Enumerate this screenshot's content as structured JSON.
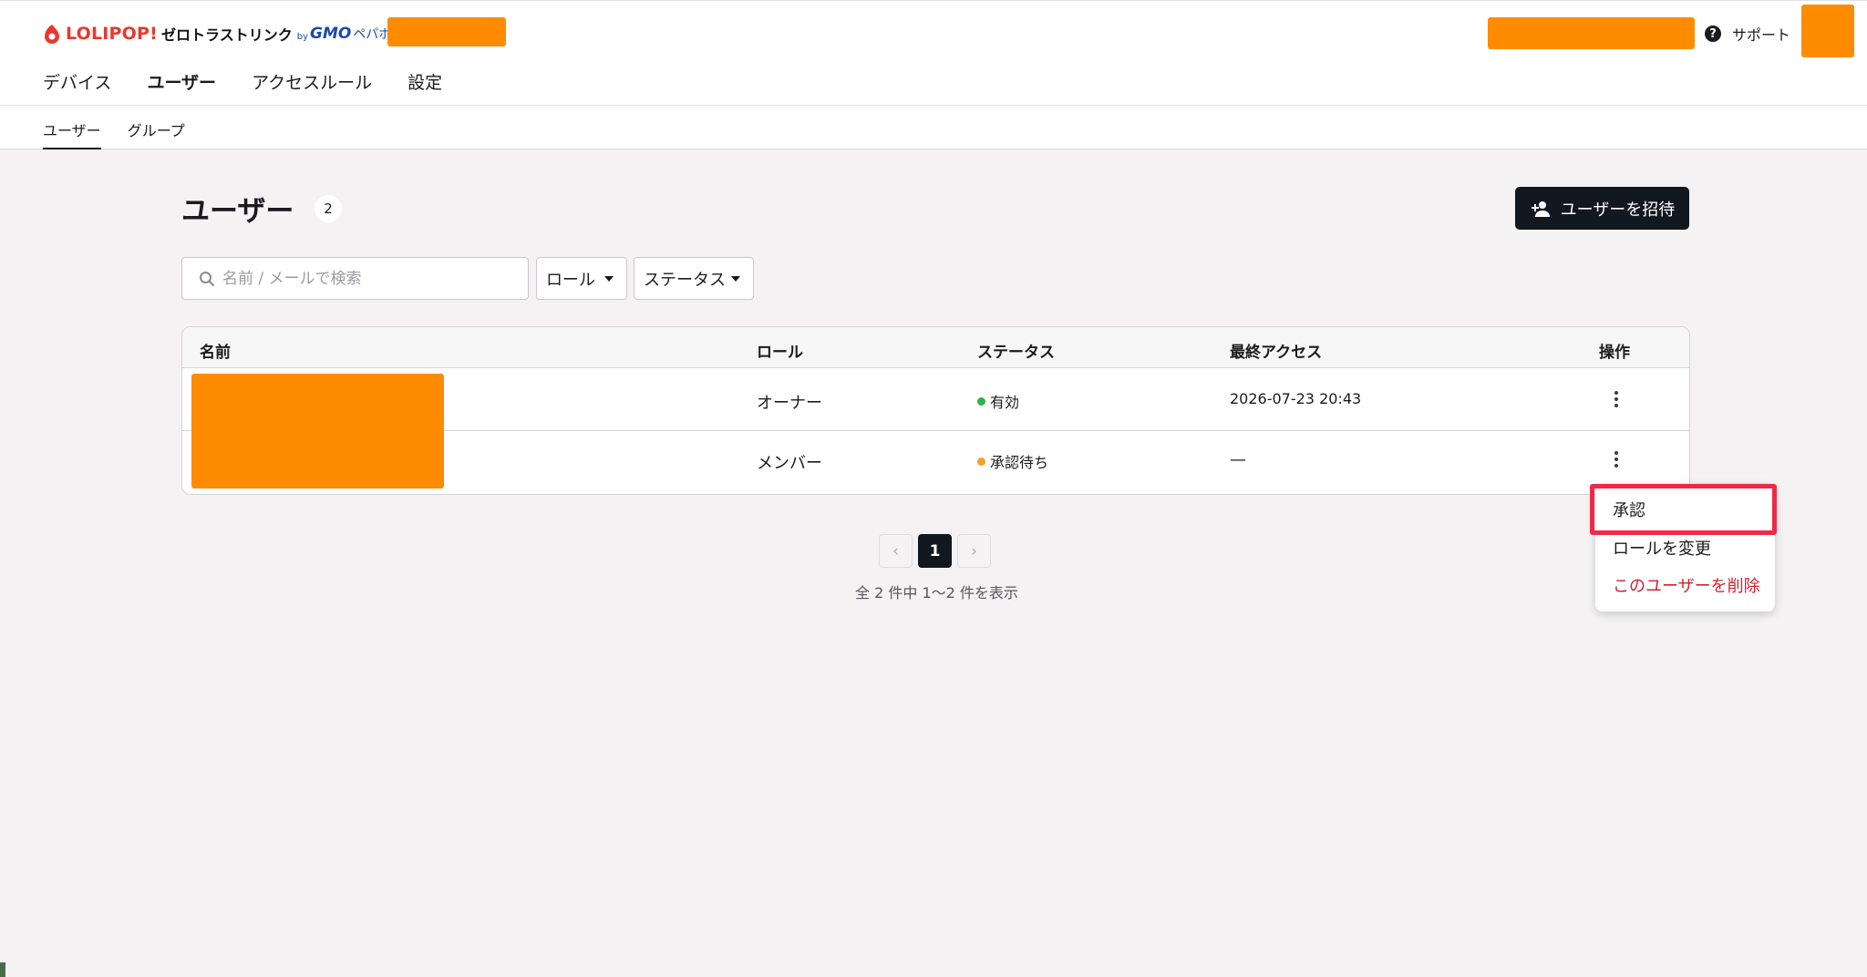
{
  "brand": {
    "lolipop": "LOLIPOP!",
    "product": "ゼロトラストリンク",
    "by": "by",
    "gmo": "GMO",
    "pepabo": "ペパボ"
  },
  "header": {
    "support_label": "サポート",
    "help_icon_glyph": "?"
  },
  "main_nav": [
    "デバイス",
    "ユーザー",
    "アクセスルール",
    "設定"
  ],
  "sub_nav": [
    "ユーザー",
    "グループ"
  ],
  "page": {
    "title": "ユーザー",
    "count": "2",
    "invite_label": "ユーザーを招待"
  },
  "filters": {
    "search_placeholder": "名前 / メールで検索",
    "role_label": "ロール",
    "status_label": "ステータス"
  },
  "table": {
    "columns": [
      "名前",
      "ロール",
      "ステータス",
      "最終アクセス",
      "操作"
    ],
    "rows": [
      {
        "role": "オーナー",
        "status": "有効",
        "status_color": "#2fb344",
        "last_access": "2026-07-23 20:43"
      },
      {
        "role": "メンバー",
        "status": "承認待ち",
        "status_color": "#f0a030",
        "last_access": "—"
      }
    ]
  },
  "pagination": {
    "prev": "‹",
    "current": "1",
    "next": "›",
    "summary": "全 2 件中 1〜2 件を表示"
  },
  "row_menu": {
    "items": [
      "承認",
      "ロールを変更",
      "このユーザーを削除"
    ]
  },
  "colors": {
    "accent_dark": "#121820",
    "redaction": "#ff8c00",
    "highlight": "#ee2a45",
    "danger": "#d3202f"
  }
}
